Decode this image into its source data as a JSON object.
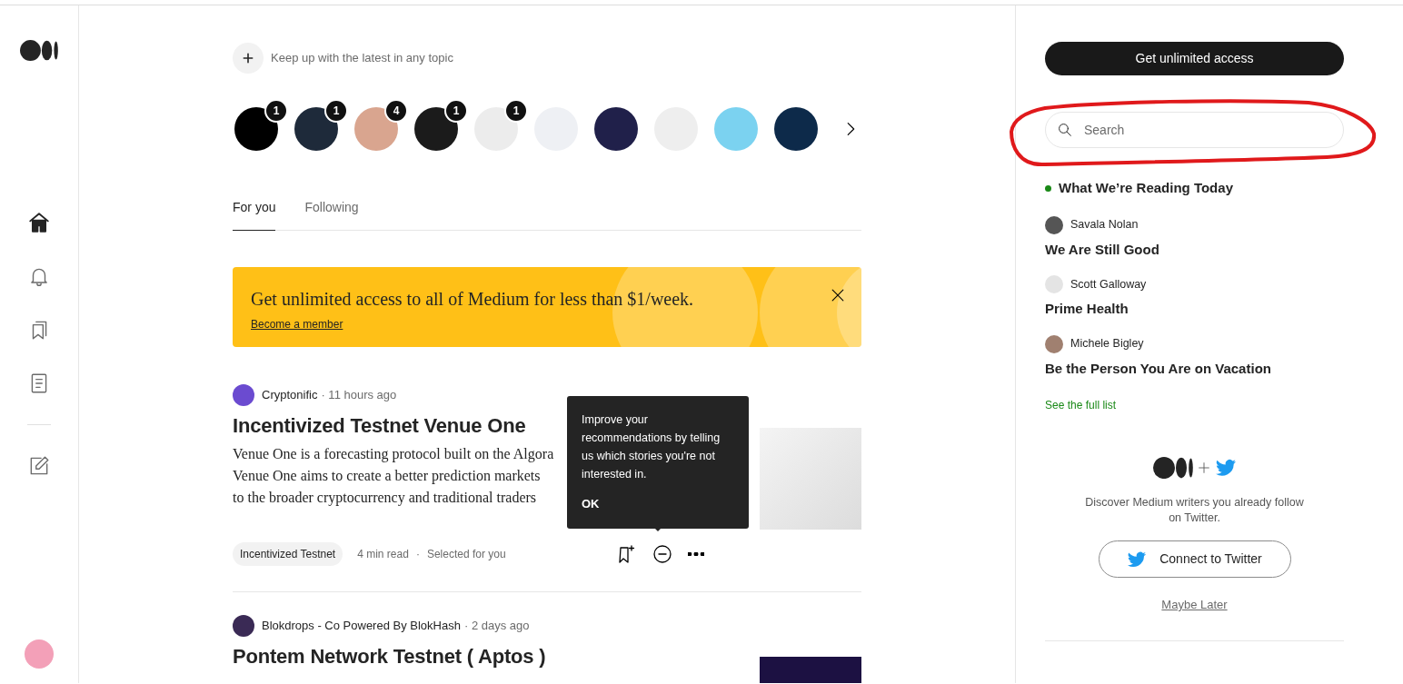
{
  "sidebar": {
    "nav_main": [
      {
        "kind": "home",
        "selected": true
      },
      {
        "kind": "notifications",
        "selected": false
      },
      {
        "kind": "lists",
        "selected": false
      },
      {
        "kind": "stories",
        "selected": false
      }
    ],
    "nav_secondary": [
      {
        "kind": "write",
        "selected": false
      }
    ]
  },
  "topics": {
    "add_label": "Keep up with the latest in any topic",
    "items": [
      {
        "kind": "badged",
        "badge": "1"
      },
      {
        "kind": "badged",
        "badge": "1"
      },
      {
        "kind": "badged",
        "badge": "4"
      },
      {
        "kind": "badged",
        "badge": "1"
      },
      {
        "kind": "badged",
        "badge": "1"
      },
      {
        "kind": "plain"
      },
      {
        "kind": "plain"
      },
      {
        "kind": "plain"
      },
      {
        "kind": "plain"
      },
      {
        "kind": "plain"
      }
    ]
  },
  "tabs": [
    {
      "label": "For you",
      "selected": true
    },
    {
      "label": "Following",
      "selected": false
    }
  ],
  "banner": {
    "text": "Get unlimited access to all of Medium for less than $1/week.",
    "link": "Become a member"
  },
  "stories": [
    {
      "author": "Cryptonific",
      "time": "· 11 hours ago",
      "title": "Incentivized Testnet Venue One",
      "excerpt_lines": [
        "Venue One is a forecasting protocol built on the Algora",
        "Venue One aims to create a better prediction markets",
        "to the broader cryptocurrency and traditional traders"
      ],
      "tag": "Incentivized Testnet",
      "read_time": "4 min read",
      "separator": "·",
      "reason": "Selected for you"
    },
    {
      "author": "Blokdrops - Co Powered By BlokHash",
      "time": "· 2 days ago",
      "title": "Pontem Network Testnet ( Aptos )"
    }
  ],
  "tooltip": {
    "text": "Improve your recommendations by telling us which stories you're not interested in.",
    "button": "OK"
  },
  "right": {
    "cta": "Get unlimited access",
    "search": {
      "placeholder": "Search"
    },
    "reading": {
      "heading": "What We’re Reading Today",
      "items": [
        {
          "author": "Savala Nolan",
          "title": "We Are Still Good"
        },
        {
          "author": "Scott Galloway",
          "title": "Prime Health"
        },
        {
          "author": "Michele Bigley",
          "title": "Be the Person You Are on Vacation"
        }
      ],
      "link": "See the full list"
    },
    "twitter": {
      "text": "Discover Medium writers you already follow on Twitter.",
      "button": "Connect to Twitter",
      "dismiss": "Maybe Later"
    }
  }
}
